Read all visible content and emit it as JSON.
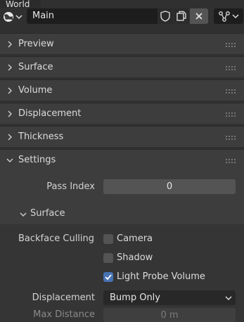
{
  "tooltip": "World",
  "datablock": {
    "name": "Main",
    "world_icon": "world-icon",
    "fake_user_icon": "shield-icon",
    "duplicate_icon": "duplicate-icon",
    "unlink_icon": "close-icon",
    "node_icon": "node-tree-icon"
  },
  "panels": [
    {
      "label": "Preview",
      "expanded": false
    },
    {
      "label": "Surface",
      "expanded": false
    },
    {
      "label": "Volume",
      "expanded": false
    },
    {
      "label": "Displacement",
      "expanded": false
    },
    {
      "label": "Thickness",
      "expanded": false
    },
    {
      "label": "Settings",
      "expanded": true
    }
  ],
  "settings": {
    "pass_index_label": "Pass Index",
    "pass_index_value": "0",
    "surface_subpanel": "Surface",
    "backface_culling_label": "Backface Culling",
    "checks": [
      {
        "label": "Camera",
        "checked": false
      },
      {
        "label": "Shadow",
        "checked": false
      },
      {
        "label": "Light Probe Volume",
        "checked": true
      }
    ],
    "displacement_label": "Displacement",
    "displacement_value": "Bump Only",
    "max_distance_label": "Max Distance",
    "max_distance_value": "0 m"
  },
  "colors": {
    "checkbox_on": "#4772b3",
    "field": "#545454",
    "panel_header": "#3d3d3d"
  }
}
